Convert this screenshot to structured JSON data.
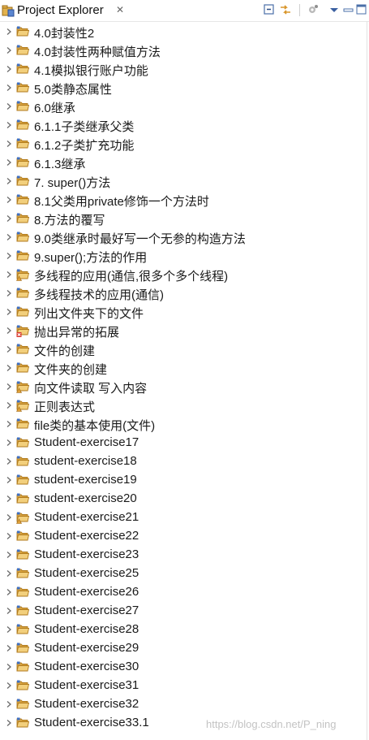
{
  "view": {
    "title": "Project Explorer",
    "close_glyph": "✕",
    "toolbar": [
      "collapse-all-icon",
      "link-with-editor-icon",
      "filter-icon",
      "view-menu-icon",
      "minimize-icon",
      "maximize-icon"
    ]
  },
  "projects": [
    {
      "label": "4.0封装性2",
      "badge": "none"
    },
    {
      "label": "4.0封装性两种赋值方法",
      "badge": "none"
    },
    {
      "label": "4.1模拟银行账户功能",
      "badge": "none"
    },
    {
      "label": "5.0类静态属性",
      "badge": "none"
    },
    {
      "label": "6.0继承",
      "badge": "none"
    },
    {
      "label": "6.1.1子类继承父类",
      "badge": "none"
    },
    {
      "label": "6.1.2子类扩充功能",
      "badge": "none"
    },
    {
      "label": "6.1.3继承",
      "badge": "none"
    },
    {
      "label": "7. super()方法",
      "badge": "none"
    },
    {
      "label": "8.1父类用private修饰一个方法时",
      "badge": "none"
    },
    {
      "label": "8.方法的覆写",
      "badge": "none"
    },
    {
      "label": "9.0类继承时最好写一个无参的构造方法",
      "badge": "none"
    },
    {
      "label": "9.super();方法的作用",
      "badge": "none"
    },
    {
      "label": "多线程的应用(通信,很多个多个线程)",
      "badge": "warning"
    },
    {
      "label": "多线程技术的应用(通信)",
      "badge": "none"
    },
    {
      "label": "列出文件夹下的文件",
      "badge": "none"
    },
    {
      "label": "抛出异常的拓展",
      "badge": "error"
    },
    {
      "label": "文件的创建",
      "badge": "none"
    },
    {
      "label": "文件夹的创建",
      "badge": "none"
    },
    {
      "label": "向文件读取 写入内容",
      "badge": "warning"
    },
    {
      "label": "正则表达式",
      "badge": "warning"
    },
    {
      "label": "file类的基本使用(文件)",
      "badge": "none"
    },
    {
      "label": "Student-exercise17",
      "badge": "none"
    },
    {
      "label": "student-exercise18",
      "badge": "none"
    },
    {
      "label": "student-exercise19",
      "badge": "none"
    },
    {
      "label": "student-exercise20",
      "badge": "none"
    },
    {
      "label": "Student-exercise21",
      "badge": "warning"
    },
    {
      "label": "Student-exercise22",
      "badge": "none"
    },
    {
      "label": "Student-exercise23",
      "badge": "none"
    },
    {
      "label": "Student-exercise25",
      "badge": "none"
    },
    {
      "label": "Student-exercise26",
      "badge": "none"
    },
    {
      "label": "Student-exercise27",
      "badge": "none"
    },
    {
      "label": "Student-exercise28",
      "badge": "none"
    },
    {
      "label": "Student-exercise29",
      "badge": "none"
    },
    {
      "label": "Student-exercise30",
      "badge": "none"
    },
    {
      "label": "Student-exercise31",
      "badge": "none"
    },
    {
      "label": "Student-exercise32",
      "badge": "none"
    },
    {
      "label": "Student-exercise33.1",
      "badge": "none"
    }
  ],
  "watermark": "https://blog.csdn.net/P_ning",
  "colors": {
    "folder": "#d9a441",
    "folder_dark": "#b07a1c",
    "source_blue": "#3d6fc4",
    "warning": "#e2a23a",
    "error": "#d9342b"
  }
}
